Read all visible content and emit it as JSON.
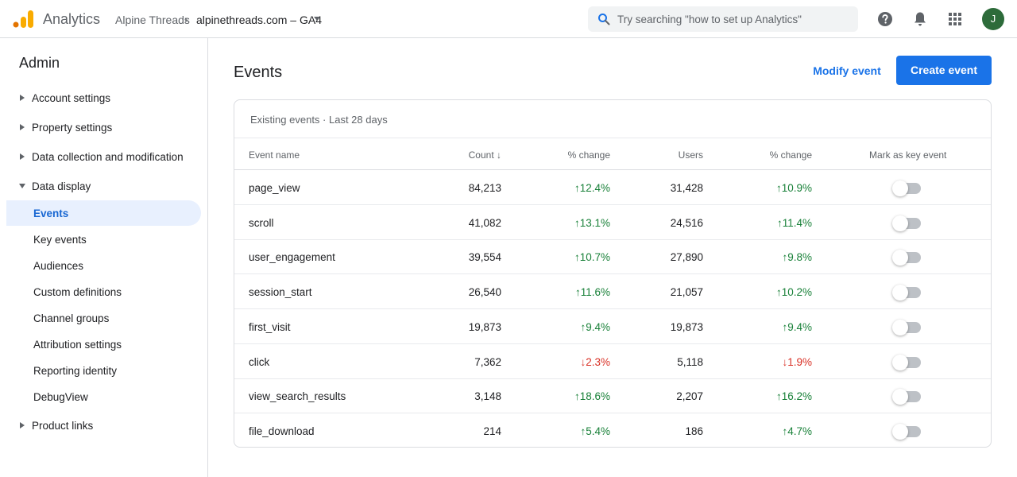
{
  "header": {
    "product": "Analytics",
    "account": "Alpine Threads",
    "separator": "›",
    "property": "alpinethreads.com – GA4",
    "search_placeholder": "Try searching \"how to set up Analytics\"",
    "avatar_initial": "J",
    "icons": [
      "analytics-logo-icon",
      "caret-down-icon",
      "search-icon",
      "help-icon",
      "bell-icon",
      "apps-icon"
    ]
  },
  "sidebar": {
    "title": "Admin",
    "groups": [
      {
        "label": "Account settings",
        "expanded": false
      },
      {
        "label": "Property settings",
        "expanded": false
      },
      {
        "label": "Data collection and modification",
        "expanded": false
      },
      {
        "label": "Data display",
        "expanded": true
      },
      {
        "label": "Product links",
        "expanded": false
      }
    ],
    "data_display_items": [
      {
        "label": "Events",
        "active": true
      },
      {
        "label": "Key events"
      },
      {
        "label": "Audiences"
      },
      {
        "label": "Custom definitions"
      },
      {
        "label": "Channel groups"
      },
      {
        "label": "Attribution settings"
      },
      {
        "label": "Reporting identity"
      },
      {
        "label": "DebugView"
      }
    ]
  },
  "main": {
    "title": "Events",
    "modify_label": "Modify event",
    "create_label": "Create event",
    "card_subtitle": "Existing events · Last 28 days",
    "columns": [
      "Event name",
      "Count ↓",
      "% change",
      "Users",
      "% change",
      "Mark as key event"
    ],
    "rows": [
      {
        "name": "page_view",
        "count": "84,213",
        "count_change": "↑12.4%",
        "count_dir": "up",
        "users": "31,428",
        "users_change": "↑10.9%",
        "users_dir": "up",
        "key_event": false
      },
      {
        "name": "scroll",
        "count": "41,082",
        "count_change": "↑13.1%",
        "count_dir": "up",
        "users": "24,516",
        "users_change": "↑11.4%",
        "users_dir": "up",
        "key_event": false
      },
      {
        "name": "user_engagement",
        "count": "39,554",
        "count_change": "↑10.7%",
        "count_dir": "up",
        "users": "27,890",
        "users_change": "↑9.8%",
        "users_dir": "up",
        "key_event": false
      },
      {
        "name": "session_start",
        "count": "26,540",
        "count_change": "↑11.6%",
        "count_dir": "up",
        "users": "21,057",
        "users_change": "↑10.2%",
        "users_dir": "up",
        "key_event": false
      },
      {
        "name": "first_visit",
        "count": "19,873",
        "count_change": "↑9.4%",
        "count_dir": "up",
        "users": "19,873",
        "users_change": "↑9.4%",
        "users_dir": "up",
        "key_event": false
      },
      {
        "name": "click",
        "count": "7,362",
        "count_change": "↓2.3%",
        "count_dir": "down",
        "users": "5,118",
        "users_change": "↓1.9%",
        "users_dir": "down",
        "key_event": false
      },
      {
        "name": "view_search_results",
        "count": "3,148",
        "count_change": "↑18.6%",
        "count_dir": "up",
        "users": "2,207",
        "users_change": "↑16.2%",
        "users_dir": "up",
        "key_event": false
      },
      {
        "name": "file_download",
        "count": "214",
        "count_change": "↑5.4%",
        "count_dir": "up",
        "users": "186",
        "users_change": "↑4.7%",
        "users_dir": "up",
        "key_event": false
      }
    ]
  },
  "colors": {
    "accent": "#1a73e8",
    "positive": "#188038",
    "negative": "#d93025",
    "active_nav_bg": "#e8f0fe",
    "avatar_bg": "#2d6b3a"
  }
}
